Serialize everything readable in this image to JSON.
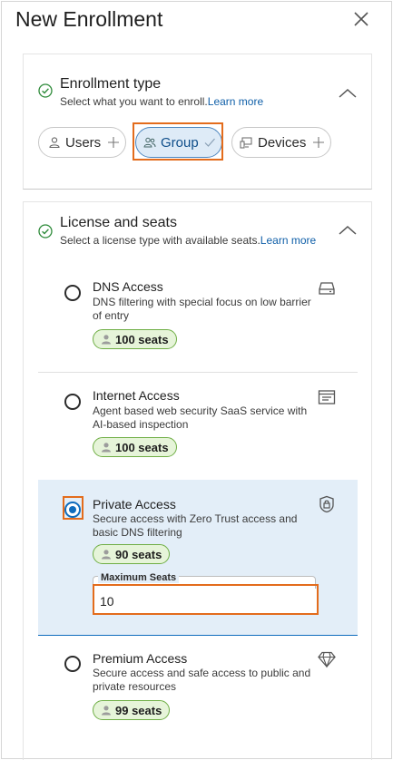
{
  "header": {
    "title": "New Enrollment",
    "close_icon": "close-icon"
  },
  "enrollment_type": {
    "title": "Enrollment type",
    "subtitle": "Select what you want to enroll.",
    "link": "Learn more",
    "chips": [
      {
        "label": "Users",
        "icon": "person-icon",
        "tail": "plus-icon",
        "selected": false
      },
      {
        "label": "Group",
        "icon": "group-icon",
        "tail": "check-icon",
        "selected": true
      },
      {
        "label": "Devices",
        "icon": "devices-icon",
        "tail": "plus-icon",
        "selected": false
      }
    ]
  },
  "license": {
    "title": "License and seats",
    "subtitle": "Select a license type with available seats.",
    "link": "Learn more",
    "options": [
      {
        "title": "DNS Access",
        "desc": "DNS filtering with special focus on low barrier of entry",
        "seats": "100 seats",
        "icon": "drive-icon",
        "selected": false
      },
      {
        "title": "Internet Access",
        "desc": "Agent based web security SaaS service with AI-based inspection",
        "seats": "100 seats",
        "icon": "web-window-icon",
        "selected": false
      },
      {
        "title": "Private Access",
        "desc": "Secure access with Zero Trust access and basic DNS filtering",
        "seats": "90 seats",
        "icon": "shield-lock-icon",
        "selected": true
      },
      {
        "title": "Premium Access",
        "desc": "Secure access and safe access to public and private resources",
        "seats": "99 seats",
        "icon": "diamond-icon",
        "selected": false
      }
    ],
    "max_seats": {
      "label": "Maximum Seats",
      "value": "10"
    }
  },
  "colors": {
    "accent": "#0f6cbd",
    "highlight": "#e36c1c",
    "seat_green": "#6fae45",
    "selected_bg": "#e3eef8"
  }
}
